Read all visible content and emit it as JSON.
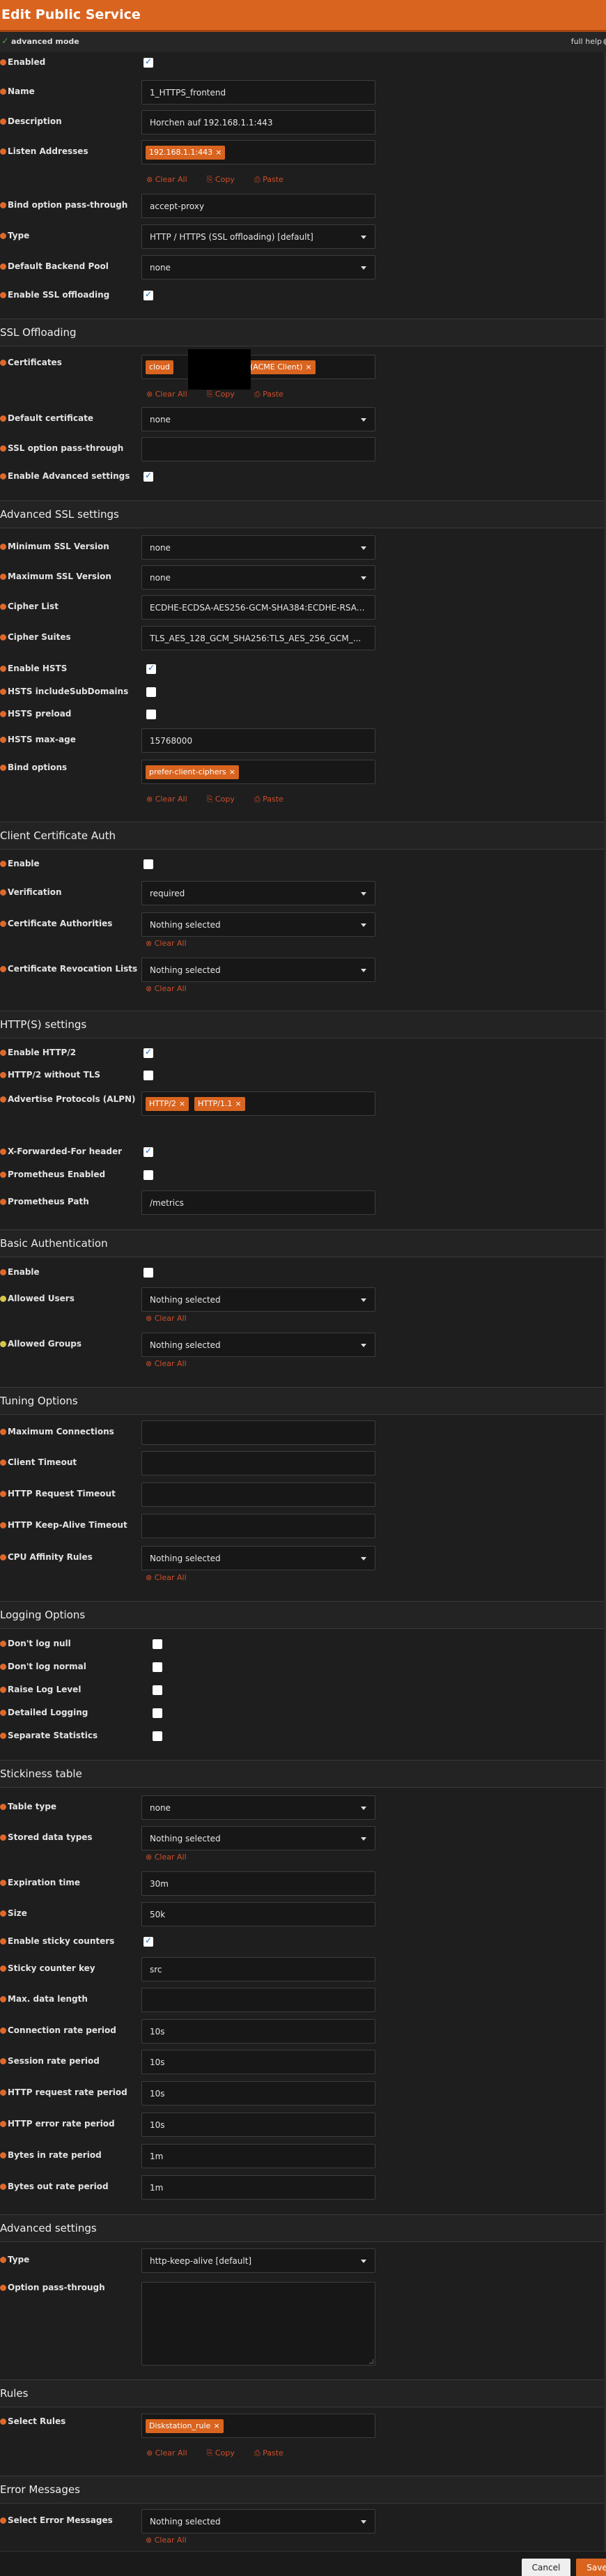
{
  "header": {
    "title": "Edit Public Service"
  },
  "topbar": {
    "advanced_mode": "advanced mode",
    "full_help": "full help"
  },
  "actions": {
    "clear_all": "Clear All",
    "copy": "Copy",
    "paste": "Paste"
  },
  "general": {
    "enabled": {
      "label": "Enabled",
      "checked": true
    },
    "name": {
      "label": "Name",
      "value": "1_HTTPS_frontend"
    },
    "description": {
      "label": "Description",
      "value": "Horchen auf 192.168.1.1:443"
    },
    "listen": {
      "label": "Listen Addresses",
      "tag": "192.168.1.1:443"
    },
    "bind_pass": {
      "label": "Bind option pass-through",
      "value": "accept-proxy"
    },
    "type": {
      "label": "Type",
      "value": "HTTP / HTTPS (SSL offloading) [default]"
    },
    "backend": {
      "label": "Default Backend Pool",
      "value": "none"
    },
    "ssl_offload": {
      "label": "Enable SSL offloading",
      "checked": true
    }
  },
  "ssl": {
    "title": "SSL Offloading",
    "certificates": {
      "label": "Certificates",
      "tag_start": "cloud",
      "tag_end": "(ACME Client)"
    },
    "default_cert": {
      "label": "Default certificate",
      "value": "none"
    },
    "ssl_pass": {
      "label": "SSL option pass-through",
      "value": ""
    },
    "adv_settings": {
      "label": "Enable Advanced settings",
      "checked": true
    }
  },
  "adv_ssl": {
    "title": "Advanced SSL settings",
    "min_ssl": {
      "label": "Minimum SSL Version",
      "value": "none"
    },
    "max_ssl": {
      "label": "Maximum SSL Version",
      "value": "none"
    },
    "cipher_list": {
      "label": "Cipher List",
      "value": "ECDHE-ECDSA-AES256-GCM-SHA384:ECDHE-RSA-..."
    },
    "cipher_suites": {
      "label": "Cipher Suites",
      "value": "TLS_AES_128_GCM_SHA256:TLS_AES_256_GCM_..."
    },
    "hsts": {
      "label": "Enable HSTS",
      "checked": true
    },
    "hsts_sub": {
      "label": "HSTS includeSubDomains",
      "checked": false
    },
    "hsts_preload": {
      "label": "HSTS preload",
      "checked": false
    },
    "hsts_maxage": {
      "label": "HSTS max-age",
      "value": "15768000"
    },
    "bind_options": {
      "label": "Bind options",
      "tag": "prefer-client-ciphers"
    }
  },
  "client_cert": {
    "title": "Client Certificate Auth",
    "enable": {
      "label": "Enable",
      "checked": false
    },
    "verification": {
      "label": "Verification",
      "value": "required"
    },
    "ca": {
      "label": "Certificate Authorities",
      "value": "Nothing selected"
    },
    "crl": {
      "label": "Certificate Revocation Lists",
      "value": "Nothing selected"
    }
  },
  "http": {
    "title": "HTTP(S) settings",
    "http2": {
      "label": "Enable HTTP/2",
      "checked": true
    },
    "http2_notls": {
      "label": "HTTP/2 without TLS",
      "checked": false
    },
    "alpn": {
      "label": "Advertise Protocols (ALPN)",
      "tags": [
        "HTTP/2",
        "HTTP/1.1"
      ]
    },
    "xff": {
      "label": "X-Forwarded-For header",
      "checked": true
    },
    "prometheus": {
      "label": "Prometheus Enabled",
      "checked": false
    },
    "prom_path": {
      "label": "Prometheus Path",
      "value": "/metrics"
    }
  },
  "basic_auth": {
    "title": "Basic Authentication",
    "enable": {
      "label": "Enable",
      "checked": false
    },
    "users": {
      "label": "Allowed Users",
      "value": "Nothing selected"
    },
    "groups": {
      "label": "Allowed Groups",
      "value": "Nothing selected"
    }
  },
  "tuning": {
    "title": "Tuning Options",
    "max_conn": {
      "label": "Maximum Connections",
      "value": ""
    },
    "client_timeout": {
      "label": "Client Timeout",
      "value": ""
    },
    "req_timeout": {
      "label": "HTTP Request Timeout",
      "value": ""
    },
    "ka_timeout": {
      "label": "HTTP Keep-Alive Timeout",
      "value": ""
    },
    "cpu": {
      "label": "CPU Affinity Rules",
      "value": "Nothing selected"
    }
  },
  "logging": {
    "title": "Logging Options",
    "no_null": {
      "label": "Don't log null",
      "checked": false
    },
    "no_normal": {
      "label": "Don't log normal",
      "checked": false
    },
    "raise": {
      "label": "Raise Log Level",
      "checked": false
    },
    "detailed": {
      "label": "Detailed Logging",
      "checked": false
    },
    "separate": {
      "label": "Separate Statistics",
      "checked": false
    }
  },
  "stick": {
    "title": "Stickiness table",
    "table_type": {
      "label": "Table type",
      "value": "none"
    },
    "stored": {
      "label": "Stored data types",
      "value": "Nothing selected"
    },
    "expire": {
      "label": "Expiration time",
      "value": "30m"
    },
    "size": {
      "label": "Size",
      "value": "50k"
    },
    "sticky_counters": {
      "label": "Enable sticky counters",
      "checked": true
    },
    "counter_key": {
      "label": "Sticky counter key",
      "value": "src"
    },
    "max_len": {
      "label": "Max. data length",
      "value": ""
    },
    "conn_rate": {
      "label": "Connection rate period",
      "value": "10s"
    },
    "sess_rate": {
      "label": "Session rate period",
      "value": "10s"
    },
    "req_rate": {
      "label": "HTTP request rate period",
      "value": "10s"
    },
    "err_rate": {
      "label": "HTTP error rate period",
      "value": "10s"
    },
    "bytes_in": {
      "label": "Bytes in rate period",
      "value": "1m"
    },
    "bytes_out": {
      "label": "Bytes out rate period",
      "value": "1m"
    }
  },
  "advanced": {
    "title": "Advanced settings",
    "type": {
      "label": "Type",
      "value": "http-keep-alive [default]"
    },
    "passthrough": {
      "label": "Option pass-through",
      "value": ""
    }
  },
  "rules": {
    "title": "Rules",
    "select": {
      "label": "Select Rules",
      "tag": "Diskstation_rule"
    }
  },
  "errors": {
    "title": "Error Messages",
    "select": {
      "label": "Select Error Messages",
      "value": "Nothing selected"
    }
  },
  "footer": {
    "cancel": "Cancel",
    "save": "Save"
  },
  "colors": {
    "accent": "#d9641f",
    "background": "#1e1e1e",
    "link": "#cf4f2a"
  }
}
